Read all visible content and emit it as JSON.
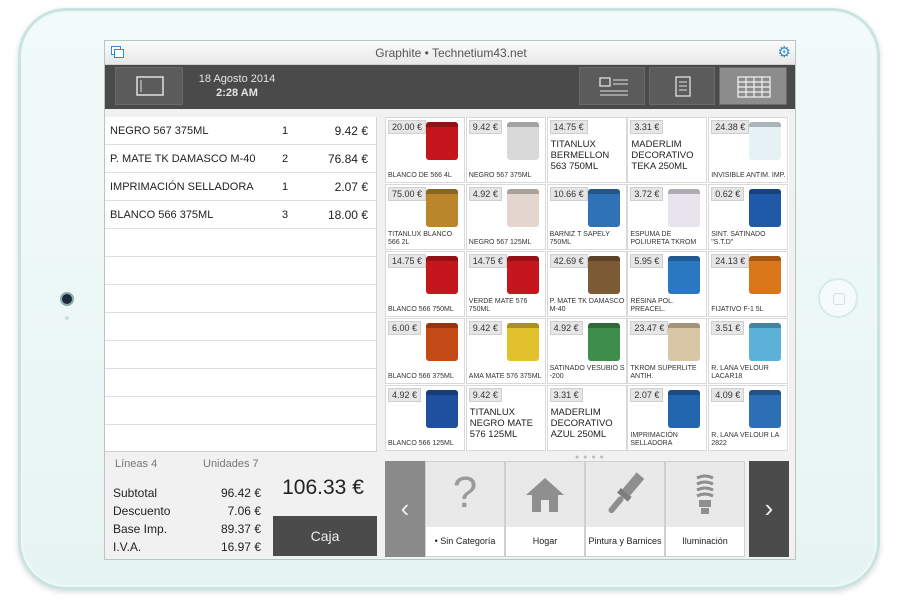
{
  "window": {
    "title": "Graphite • Technetium43.net"
  },
  "header": {
    "date": "18 Agosto 2014",
    "time": "2:28 AM"
  },
  "ticket": {
    "lines": [
      {
        "name": "NEGRO 567 375ML",
        "qty": "1",
        "price": "9.42 €"
      },
      {
        "name": "P. MATE TK DAMASCO M-40",
        "qty": "2",
        "price": "76.84 €"
      },
      {
        "name": "IMPRIMACIÓN SELLADORA",
        "qty": "1",
        "price": "2.07 €"
      },
      {
        "name": "BLANCO 566 375ML",
        "qty": "3",
        "price": "18.00 €"
      }
    ]
  },
  "totals": {
    "lines_label": "Líneas 4",
    "units_label": "Unidades 7",
    "subtotal_label": "Subtotal",
    "subtotal": "96.42 €",
    "discount_label": "Descuento",
    "discount": "7.06 €",
    "base_label": "Base Imp.",
    "base": "89.37 €",
    "iva_label": "I.V.A.",
    "iva": "16.97 €",
    "grand_total": "106.33 €",
    "checkout_label": "Caja"
  },
  "products": [
    {
      "price": "20.00 €",
      "name": "BLANCO DE 566 4L",
      "color": "#c4161c",
      "style": "image"
    },
    {
      "price": "9.42 €",
      "name": "NEGRO 567 375ML",
      "color": "#d9d9d9",
      "style": "image"
    },
    {
      "price": "14.75 €",
      "name": "TITANLUX BERMELLON 563 750ML",
      "color": "",
      "style": "text"
    },
    {
      "price": "3.31 €",
      "name": "MADERLIM DECORATIVO TEKA 250ML",
      "color": "",
      "style": "text"
    },
    {
      "price": "24.38 €",
      "name": "INVISIBLE ANTIM. IMP.",
      "color": "#e5f1f5",
      "style": "image"
    },
    {
      "price": "75.00 €",
      "name": "TITANLUX BLANCO 566 2L",
      "color": "#b9862b",
      "style": "image"
    },
    {
      "price": "4.92 €",
      "name": "NEGRO 567 125ML",
      "color": "#e4d7d0",
      "style": "image"
    },
    {
      "price": "10.66 €",
      "name": "BARNIZ T SAPELY 750ML",
      "color": "#2f73b6",
      "style": "image"
    },
    {
      "price": "3.72 €",
      "name": "ESPUMA DE POLIURETA TKROM",
      "color": "#e8e4ee",
      "style": "image"
    },
    {
      "price": "0.62 €",
      "name": "SINT. SATINADO \"S.T.D\"",
      "color": "#1e5aa8",
      "style": "image"
    },
    {
      "price": "14.75 €",
      "name": "BLANCO 566 750ML",
      "color": "#c4161c",
      "style": "image"
    },
    {
      "price": "14.75 €",
      "name": "VERDE MATE 576 750ML",
      "color": "#c4161c",
      "style": "image"
    },
    {
      "price": "42.69 €",
      "name": "P. MATE TK DAMASCO M-40",
      "color": "#7b5a35",
      "style": "image"
    },
    {
      "price": "5.95 €",
      "name": "RESINA POL. PREACEL.",
      "color": "#2b78c2",
      "style": "image"
    },
    {
      "price": "24.13 €",
      "name": "FIJATIVO F-1 5L",
      "color": "#d9761a",
      "style": "image"
    },
    {
      "price": "6.00 €",
      "name": "BLANCO 566 375ML",
      "color": "#c44a15",
      "style": "image"
    },
    {
      "price": "9.42 €",
      "name": "AMA MATE 576 375ML",
      "color": "#e1c22c",
      "style": "image"
    },
    {
      "price": "4.92 €",
      "name": "SATINADO VESUBIO S -200",
      "color": "#3f8d4a",
      "style": "image"
    },
    {
      "price": "23.47 €",
      "name": "TKROM SUPERLITE ANTIH.",
      "color": "#d9c6a4",
      "style": "image"
    },
    {
      "price": "3.51 €",
      "name": "R. LANA VELOUR LACAR18",
      "color": "#5bb1d8",
      "style": "image"
    },
    {
      "price": "4.92 €",
      "name": "BLANCO 566 125ML",
      "color": "#1f4f9f",
      "style": "image"
    },
    {
      "price": "9.42 €",
      "name": "TITANLUX NEGRO MATE 576 125ML",
      "color": "",
      "style": "text"
    },
    {
      "price": "3.31 €",
      "name": "MADERLIM DECORATIVO AZUL 250ML",
      "color": "",
      "style": "text"
    },
    {
      "price": "2.07 €",
      "name": "IMPRIMACIÓN SELLADORA",
      "color": "#2266b0",
      "style": "image"
    },
    {
      "price": "4.09 €",
      "name": "R. LANA VELOUR LA 2822",
      "color": "#2d6fb7",
      "style": "image"
    }
  ],
  "categories": [
    {
      "label": "• Sin Categoría",
      "icon": "question-icon",
      "glyph": "?"
    },
    {
      "label": "Hogar",
      "icon": "house-icon",
      "glyph": ""
    },
    {
      "label": "Pintura y Barnices",
      "icon": "paintbrush-icon",
      "glyph": ""
    },
    {
      "label": "Iluminación",
      "icon": "lightbulb-icon",
      "glyph": ""
    }
  ],
  "arrows": {
    "prev": "‹",
    "next": "›"
  },
  "pager": "● ● ● ●"
}
